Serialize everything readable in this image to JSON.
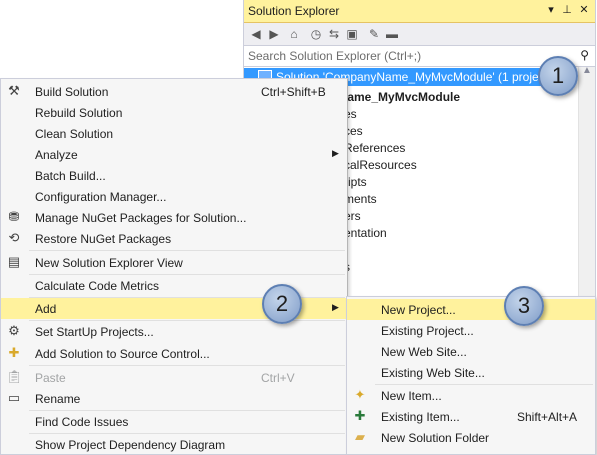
{
  "solution_explorer": {
    "title": "Solution Explorer",
    "title_buttons": [
      "▾",
      "⊥",
      "✕"
    ],
    "search_placeholder": "Search Solution Explorer (Ctrl+;)",
    "solution_row": "Solution 'CompanyName_MyMvcModule' (1 project)",
    "tree_items": [
      "lame_MyMvcModule",
      "es",
      "ces",
      "References",
      "calResources",
      "ripts",
      "ments",
      "ers",
      "entation",
      "s"
    ]
  },
  "context_menu": {
    "items": [
      {
        "label": "Build Solution",
        "shortcut": "Ctrl+Shift+B",
        "icon": "build-icon"
      },
      {
        "label": "Rebuild Solution"
      },
      {
        "label": "Clean Solution"
      },
      {
        "label": "Analyze"
      },
      {
        "label": "Batch Build..."
      },
      {
        "label": "Configuration Manager..."
      },
      {
        "label": "Manage NuGet Packages for Solution...",
        "icon": "nuget-icon"
      },
      {
        "label": "Restore NuGet Packages",
        "icon": "restore-icon"
      },
      {
        "label": "New Solution Explorer View",
        "icon": "new-view-icon"
      },
      {
        "label": "Calculate Code Metrics"
      },
      {
        "label": "Add"
      },
      {
        "label": "Set StartUp Projects...",
        "icon": "gear-icon"
      },
      {
        "label": "Add Solution to Source Control...",
        "icon": "source-control-icon"
      },
      {
        "label": "Paste",
        "shortcut": "Ctrl+V",
        "icon": "paste-icon",
        "disabled": true
      },
      {
        "label": "Rename",
        "icon": "rename-icon"
      },
      {
        "label": "Find Code Issues"
      },
      {
        "label": "Show Project Dependency Diagram"
      }
    ]
  },
  "submenu": {
    "items": [
      {
        "label": "New Project..."
      },
      {
        "label": "Existing Project..."
      },
      {
        "label": "New Web Site..."
      },
      {
        "label": "Existing Web Site..."
      },
      {
        "label": "New Item...",
        "icon": "new-item-icon"
      },
      {
        "label": "Existing Item...",
        "shortcut": "Shift+Alt+A",
        "icon": "existing-item-icon"
      },
      {
        "label": "New Solution Folder",
        "icon": "folder-icon"
      }
    ]
  },
  "callouts": [
    "1",
    "2",
    "3"
  ],
  "colors": {
    "highlight": "#fff29d",
    "selection": "#3399ff",
    "menu_bg": "#f6f6f6"
  }
}
